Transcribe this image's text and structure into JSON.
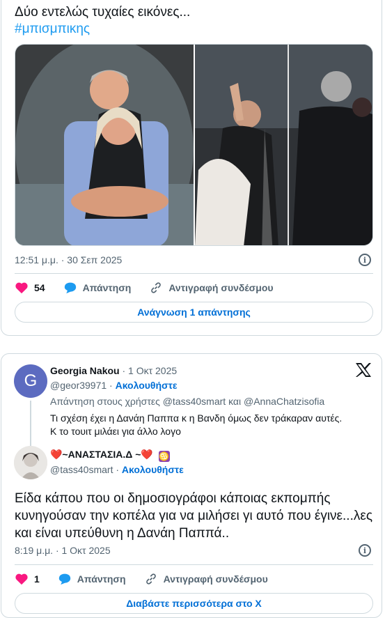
{
  "tweet1": {
    "text": "Δύο εντελώς τυχαίες εικόνες...",
    "hashtag": "#μπισμπικης",
    "timestamp": "12:51 μ.μ. · 30 Σεπ 2025",
    "likes": "54",
    "reply_label": "Απάντηση",
    "copy_link_label": "Αντιγραφή συνδέσμου",
    "read_replies_label": "Ανάγνωση 1 απάντησης"
  },
  "tweet2": {
    "parent": {
      "avatar_letter": "G",
      "name": "Georgia Nakou",
      "date": "· 1 Οκτ 2025",
      "handle": "@geor39971 ·",
      "follow": "Ακολουθήστε",
      "reply_to": "Απάντηση στους χρήστες @tass40smart και @AnnaChatzisofia",
      "text_line1": "Τι σχέση έχει η Δανάη Παππα κ η Βανδη όμως δεν τράκαραν αυτές.",
      "text_line2": "Κ το τουιτ μιλάει για άλλο λογο"
    },
    "author": {
      "name": "❤️~ΑΝΑΣΤΑΣΙΑ.Δ ~❤️",
      "handle": "@tass40smart ·",
      "follow": "Ακολουθήστε"
    },
    "text": "Είδα κάπου που οι δημοσιογράφοι κάποιας εκπομπής κυνηγούσαν την κοπέλα για να μιλήσει γι αυτό που έγινε...λες και είναι υπεύθυνη η Δανάη Παππά..",
    "timestamp": "8:19 μ.μ. · 1 Οκτ 2025",
    "likes": "1",
    "reply_label": "Απάντηση",
    "copy_link_label": "Αντιγραφή συνδέσμου",
    "more_label": "Διαβάστε περισσότερα στο X"
  },
  "colors": {
    "link": "#006fd6",
    "like": "#f91880",
    "reply": "#1d9bf0",
    "gray": "#536471"
  }
}
